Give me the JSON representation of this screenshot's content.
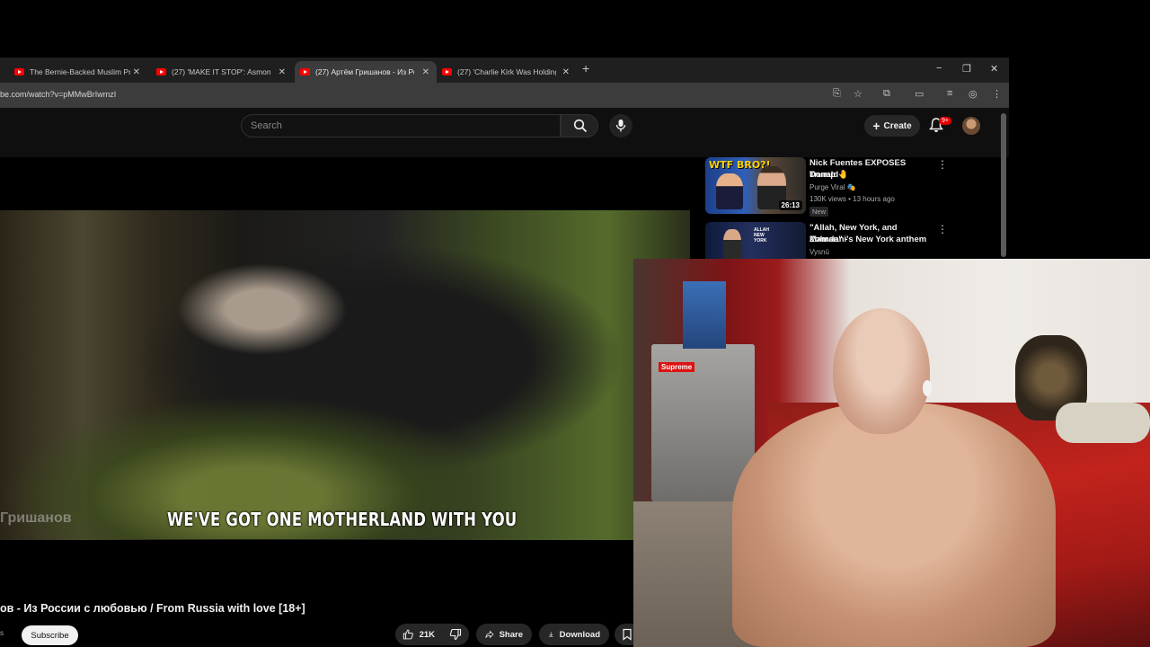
{
  "browser": {
    "tabs": [
      {
        "title": "The Bernie-Backed Muslim Pro",
        "active": false
      },
      {
        "title": "(27) 'MAKE IT STOP': Asmongol",
        "active": false
      },
      {
        "title": "(27) Артём Гришанов - Из Рос",
        "active": true
      },
      {
        "title": "(27) 'Charlie Kirk Was Holding",
        "active": false
      }
    ],
    "new_tab": "+",
    "window_controls": {
      "minimize": "−",
      "maximize": "❐",
      "close": "✕"
    },
    "url": "be.com/watch?v=pMMwBrIwmzI"
  },
  "youtube": {
    "search_placeholder": "Search",
    "create_label": "Create",
    "notifications_badge": "9+",
    "video": {
      "subtitle": "WE'VE GOT ONE MOTHERLAND WITH YOU",
      "watermark": "Гришанов",
      "title": "ов - Из России с любовью / From Russia with love [18+]"
    },
    "subscribe_label": "Subscribe",
    "actions": {
      "likes": "21K",
      "share": "Share",
      "download": "Download"
    },
    "recommendations": [
      {
        "title_line1": "Nick Fuentes EXPOSES Donald",
        "title_line2": "Trump 🤚",
        "channel": "Purge Viral 🎭",
        "meta": "130K views • 13 hours ago",
        "badge": "New",
        "duration": "26:13",
        "thumb_text": "WTF BRO?!"
      },
      {
        "title_line1": "\"Allah, New York, and Zohran\" -",
        "title_line2": "Mamdani's New York anthem",
        "channel": "Vysnū",
        "thumb_text": "ALLAH NEW YORK"
      }
    ]
  },
  "webcam": {
    "fridge_sticker": "Supreme"
  }
}
